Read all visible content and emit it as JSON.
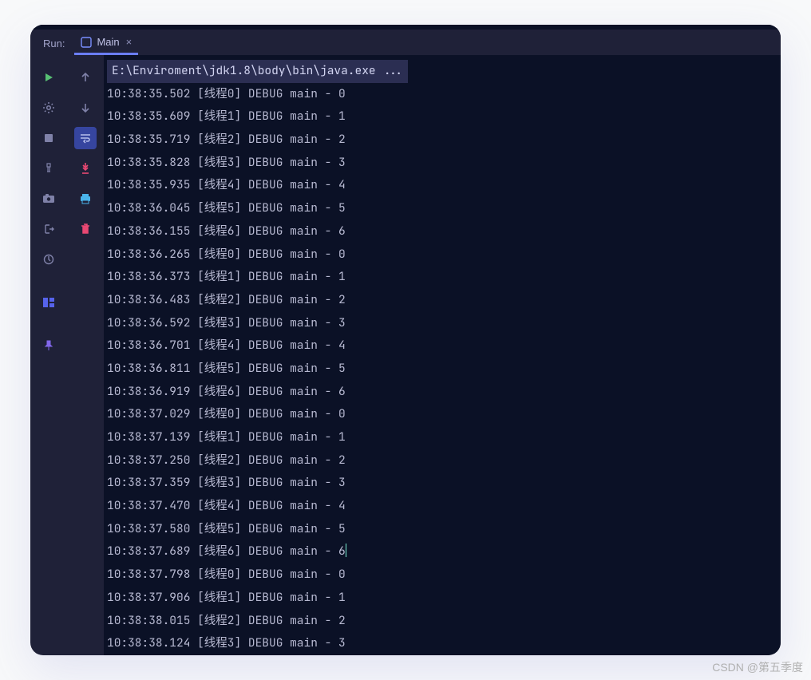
{
  "header": {
    "run_label": "Run:",
    "tab_label": "Main"
  },
  "console": {
    "command": "E:\\Enviroment\\jdk1.8\\body\\bin\\java.exe ...",
    "lines": [
      "10:38:35.502 [线程0] DEBUG main - 0",
      "10:38:35.609 [线程1] DEBUG main - 1",
      "10:38:35.719 [线程2] DEBUG main - 2",
      "10:38:35.828 [线程3] DEBUG main - 3",
      "10:38:35.935 [线程4] DEBUG main - 4",
      "10:38:36.045 [线程5] DEBUG main - 5",
      "10:38:36.155 [线程6] DEBUG main - 6",
      "10:38:36.265 [线程0] DEBUG main - 0",
      "10:38:36.373 [线程1] DEBUG main - 1",
      "10:38:36.483 [线程2] DEBUG main - 2",
      "10:38:36.592 [线程3] DEBUG main - 3",
      "10:38:36.701 [线程4] DEBUG main - 4",
      "10:38:36.811 [线程5] DEBUG main - 5",
      "10:38:36.919 [线程6] DEBUG main - 6",
      "10:38:37.029 [线程0] DEBUG main - 0",
      "10:38:37.139 [线程1] DEBUG main - 1",
      "10:38:37.250 [线程2] DEBUG main - 2",
      "10:38:37.359 [线程3] DEBUG main - 3",
      "10:38:37.470 [线程4] DEBUG main - 4",
      "10:38:37.580 [线程5] DEBUG main - 5",
      "10:38:37.689 [线程6] DEBUG main - 6",
      "10:38:37.798 [线程0] DEBUG main - 0",
      "10:38:37.906 [线程1] DEBUG main - 1",
      "10:38:38.015 [线程2] DEBUG main - 2",
      "10:38:38.124 [线程3] DEBUG main - 3"
    ],
    "cursor_line": 20
  },
  "watermark": "CSDN @第五季度"
}
